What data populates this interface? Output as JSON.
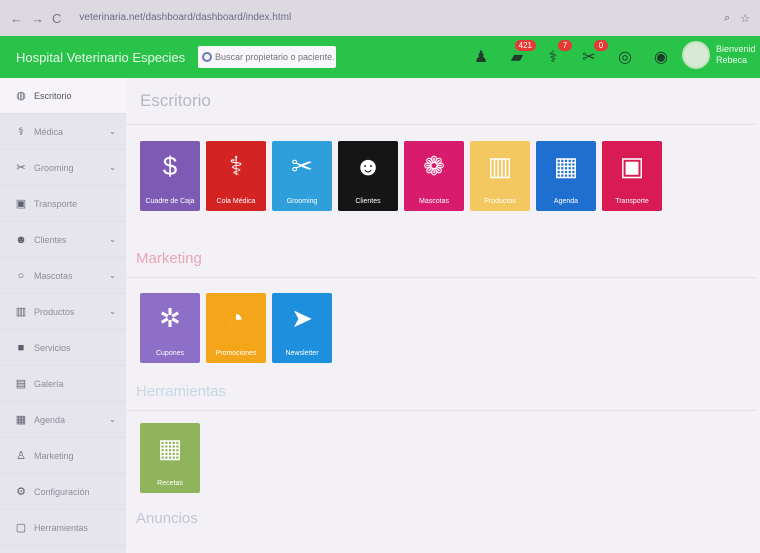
{
  "browser": {
    "url": "veterinaria.net/dashboard/dashboard/index.html"
  },
  "header": {
    "brand": "Hospital Veterinario Especies",
    "search_placeholder": "Buscar propietario o paciente...",
    "icons": [
      {
        "name": "user-add-icon",
        "glyph": "♟",
        "badge": ""
      },
      {
        "name": "messages-icon",
        "glyph": "▰",
        "badge": "421"
      },
      {
        "name": "stethoscope-icon",
        "glyph": "⚕",
        "badge": "7"
      },
      {
        "name": "scissors-icon",
        "glyph": "✂",
        "badge": "0"
      },
      {
        "name": "lifebuoy-icon",
        "glyph": "◎",
        "badge": ""
      },
      {
        "name": "globe-icon",
        "glyph": "◉",
        "badge": ""
      }
    ],
    "user": {
      "greeting": "Bienvenid",
      "name": "Rebeca"
    }
  },
  "sidebar": {
    "items": [
      {
        "label": "Escritorio",
        "icon": "◍",
        "chevron": ""
      },
      {
        "label": "Médica",
        "icon": "⚕",
        "chevron": "⌄"
      },
      {
        "label": "Grooming",
        "icon": "✂",
        "chevron": "⌄"
      },
      {
        "label": "Transporte",
        "icon": "▣",
        "chevron": ""
      },
      {
        "label": "Clientes",
        "icon": "☻",
        "chevron": "⌄"
      },
      {
        "label": "Mascotas",
        "icon": "○",
        "chevron": "⌄"
      },
      {
        "label": "Productos",
        "icon": "▥",
        "chevron": "⌄"
      },
      {
        "label": "Servicios",
        "icon": "■",
        "chevron": ""
      },
      {
        "label": "Galería",
        "icon": "▤",
        "chevron": ""
      },
      {
        "label": "Agenda",
        "icon": "▦",
        "chevron": "⌄"
      },
      {
        "label": "Marketing",
        "icon": "♙",
        "chevron": ""
      },
      {
        "label": "Configuración",
        "icon": "⚙",
        "chevron": ""
      },
      {
        "label": "Herramientas",
        "icon": "▢",
        "chevron": ""
      }
    ]
  },
  "main": {
    "section_escritorio": "Escritorio",
    "tiles_escritorio": [
      {
        "label": "Cuadre de Caja",
        "icon": "$",
        "color": "#7d5bb5"
      },
      {
        "label": "Cola Médica",
        "icon": "⚕",
        "color": "#d42323"
      },
      {
        "label": "Grooming",
        "icon": "✂",
        "color": "#2f9fdc"
      },
      {
        "label": "Clientes",
        "icon": "☻",
        "color": "#151515"
      },
      {
        "label": "Mascotas",
        "icon": "❁",
        "color": "#d81b6d"
      },
      {
        "label": "Productos",
        "icon": "▥",
        "color": "#f3c860"
      },
      {
        "label": "Agenda",
        "icon": "▦",
        "color": "#1f6fd0"
      },
      {
        "label": "Transporte",
        "icon": "▣",
        "color": "#d81b53"
      }
    ],
    "section_marketing": "Marketing",
    "tiles_marketing": [
      {
        "label": "Cupones",
        "icon": "✲",
        "color": "#8e6fc7"
      },
      {
        "label": "Promociones",
        "icon": "◔",
        "color": "#f5a51a"
      },
      {
        "label": "Newsletter",
        "icon": "➤",
        "color": "#1d8fdc"
      }
    ],
    "section_herramientas": "Herramientas",
    "tiles_herramientas": [
      {
        "label": "Recetas",
        "icon": "▦",
        "color": "#8fb45b"
      }
    ],
    "section_anuncios": "Anuncios"
  }
}
